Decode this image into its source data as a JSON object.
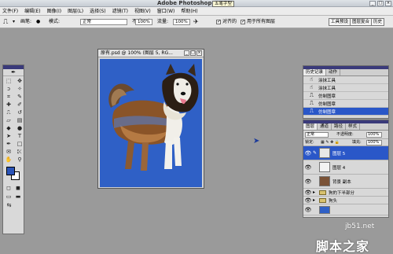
{
  "window": {
    "title": "Adobe Photoshop",
    "tooltip": "五笔字型",
    "buttons": [
      "_",
      "□",
      "×"
    ]
  },
  "menu": [
    "文件(F)",
    "编辑(E)",
    "图像(I)",
    "图层(L)",
    "选择(S)",
    "滤镜(T)",
    "视图(V)",
    "窗口(W)",
    "帮助(H)"
  ],
  "options_bar": {
    "brush_label": "画笔:",
    "brush_size": "●",
    "mode_label": "模式:",
    "mode_value": "正常",
    "opacity_label": "不透明度:",
    "opacity_value": "100%",
    "flow_label": "流量:",
    "flow_value": "100%",
    "aligned_label": "对齐的",
    "all_layers_label": "用于所有图层",
    "palette_buttons": [
      "工具预设",
      "图层复合",
      "历史"
    ]
  },
  "document": {
    "title": "原有.psd @ 100% (图层 5, RG...",
    "buttons": [
      "_",
      "□",
      "×"
    ]
  },
  "history": {
    "tabs": [
      "历史记录",
      "动作"
    ],
    "items": [
      {
        "label": "涂抹工具",
        "selected": false
      },
      {
        "label": "涂抹工具",
        "selected": false
      },
      {
        "label": "仿制图章",
        "selected": false
      },
      {
        "label": "仿制图章",
        "selected": false
      },
      {
        "label": "仿制图章",
        "selected": true
      }
    ]
  },
  "layers": {
    "tabs": [
      "图层",
      "通道",
      "路径",
      "样式"
    ],
    "blend_mode": "正常",
    "opacity_label": "不透明度:",
    "opacity_value": "100%",
    "lock_label": "锁定:",
    "fill_label": "填充:",
    "fill_value": "100%",
    "items": [
      {
        "name": "图层 5",
        "selected": true
      },
      {
        "name": "图层 4",
        "selected": false
      },
      {
        "name": "背景 副本",
        "selected": false
      },
      {
        "name": "狗的下半部分",
        "selected": false,
        "group": true
      },
      {
        "name": "狗头",
        "selected": false,
        "group": true
      }
    ]
  },
  "colors": {
    "foreground": "#2b54b8",
    "background": "#ffffff",
    "canvas_bg": "#2f60c6",
    "selection": "#2a57c8"
  },
  "watermark": {
    "url": "jb51.net",
    "site": "脚本之家"
  }
}
